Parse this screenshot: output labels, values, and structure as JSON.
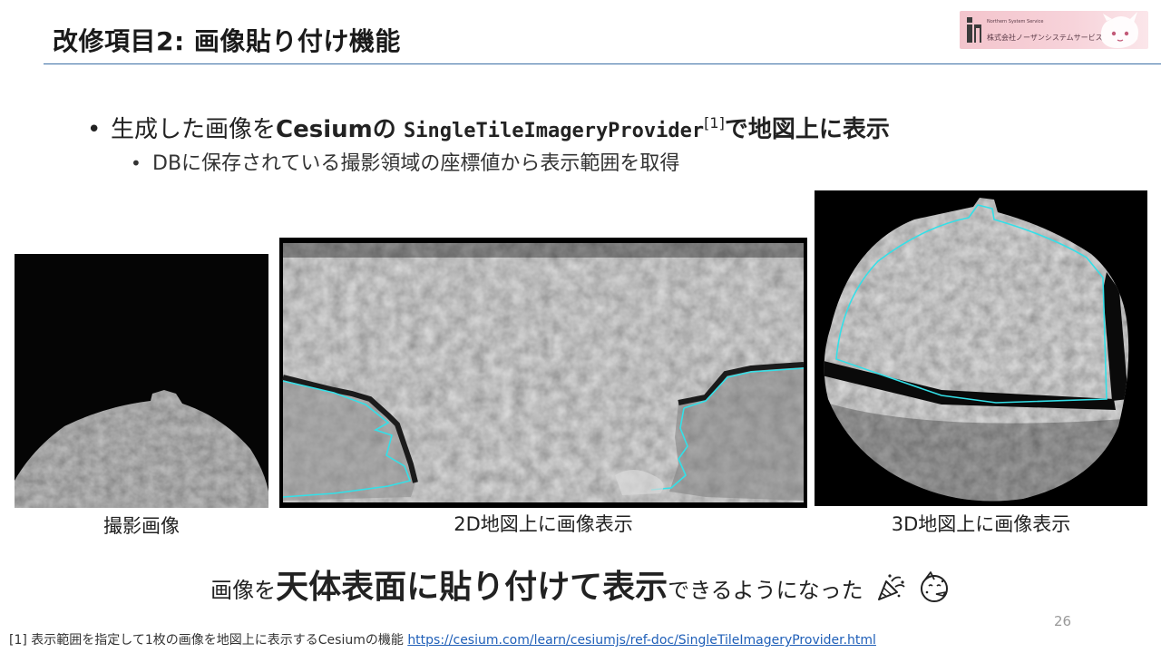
{
  "slide": {
    "title": "改修項目2: 画像貼り付け機能",
    "page_number": "26"
  },
  "logo": {
    "company": "株式会社ノーザンシステムサービス",
    "small_text": "Northern System Service"
  },
  "bullets": {
    "main": {
      "dot": "•",
      "t1": "生成した画像を",
      "t2": "Cesium",
      "t3": "の",
      "t4": "SingleTileImageryProvider",
      "t5": "[1]",
      "t6": "で地図上に表示"
    },
    "sub": {
      "dot": "•",
      "text": "DBに保存されている撮影領域の座標値から表示範囲を取得"
    }
  },
  "figures": [
    {
      "caption": "撮影画像"
    },
    {
      "caption": "2D地図上に画像表示"
    },
    {
      "caption": "3D地図上に画像表示"
    }
  ],
  "bottom": {
    "t1": "画像を",
    "t2": "天体表面に貼り付けて表示",
    "t3": "できるようになった",
    "icons": [
      "party-popper-icon",
      "partying-face-icon"
    ]
  },
  "footnote": {
    "text": "[1] 表示範囲を指定して1枚の画像を地図上に表示するCesiumの機能 ",
    "link": "https://cesium.com/learn/cesiumjs/ref-doc/SingleTileImageryProvider.html"
  },
  "colors": {
    "accent_rule": "#3a6ea5",
    "overlay_outline": "#33e0e8",
    "link": "#1f5fb8",
    "logo_background": "#f3c4cc"
  }
}
